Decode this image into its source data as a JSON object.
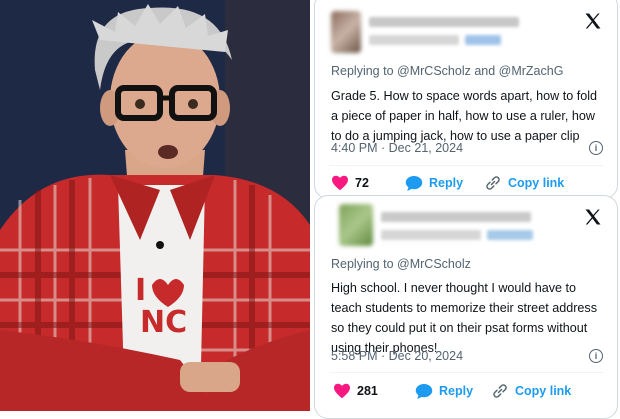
{
  "tweets": [
    {
      "replying_prefix": "Replying to",
      "handles": "@MrCScholz and @MrZachG",
      "text": "Grade 5. How to space words apart, how to fold a piece of paper in half, how to use a ruler, how to do a jumping jack, how to use a paper clip",
      "timestamp": "4:40 PM · Dec 21, 2024",
      "likes": "72",
      "reply_label": "Reply",
      "copy_link_label": "Copy link"
    },
    {
      "replying_prefix": "Replying to",
      "handles": "@MrCScholz",
      "text": "High school. I never thought I would have to teach students to memorize their street address so they could put it on their psat forms without using their phones!",
      "timestamp": "5:58 PM · Dec 20, 2024",
      "likes": "281",
      "reply_label": "Reply",
      "copy_link_label": "Copy link"
    }
  ],
  "colors": {
    "like": "#f91880",
    "reply": "#1d9bf0",
    "muted": "#536471",
    "text": "#0f1419",
    "shirt_red": "#c62a2a"
  },
  "icons": {
    "platform": "x-logo-icon",
    "like": "heart-icon",
    "reply": "speech-bubble-icon",
    "copy_link": "link-icon",
    "info": "info-icon"
  }
}
